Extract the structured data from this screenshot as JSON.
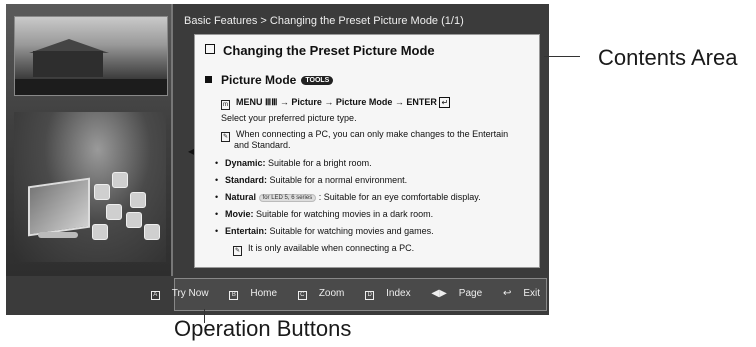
{
  "breadcrumb": "Basic Features > Changing the Preset Picture Mode (1/1)",
  "content": {
    "title": "Changing the Preset Picture Mode",
    "section_title": "Picture Mode",
    "tools_badge": "TOOLS",
    "menu_path": "MENU ⅢⅢ → Picture → Picture Mode → ENTER",
    "instruction": "Select your preferred picture type.",
    "note": "When connecting a PC, you can only make changes to the Entertain and Standard.",
    "note_line1": "When connecting a PC, you can only make changes to the Entertain",
    "note_line2": "and Standard.",
    "modes": [
      {
        "name": "Dynamic:",
        "desc": " Suitable for a bright room."
      },
      {
        "name": "Standard:",
        "desc": " Suitable for a normal environment."
      },
      {
        "name": "Natural",
        "badge": "for LED 5, 6 series",
        "desc": " : Suitable for an eye comfortable display."
      },
      {
        "name": "Movie:",
        "desc": " Suitable for watching movies in a dark room."
      },
      {
        "name": "Entertain:",
        "desc": " Suitable for watching movies and games."
      }
    ],
    "sub_note": "It is only available when connecting a PC."
  },
  "operations": [
    {
      "key": "A",
      "label": "Try Now"
    },
    {
      "key": "B",
      "label": "Home"
    },
    {
      "key": "C",
      "label": "Zoom"
    },
    {
      "key": "D",
      "label": "Index"
    },
    {
      "key": "◀▶",
      "label": "Page"
    },
    {
      "key": "↩",
      "label": "Exit"
    }
  ],
  "callouts": {
    "contents_area": "Contents Area",
    "operation_buttons": "Operation Buttons"
  },
  "icons": [
    "left-arrow-icon",
    "right-arrow-icon",
    "note-icon",
    "enter-icon"
  ]
}
